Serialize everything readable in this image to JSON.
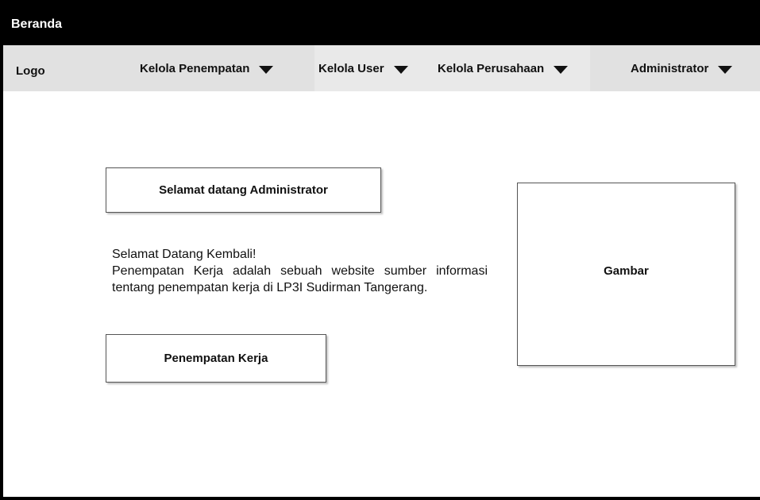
{
  "window": {
    "title": "Beranda"
  },
  "menu": {
    "logo": "Logo",
    "items": [
      {
        "label": "Kelola Penempatan"
      },
      {
        "label": "Kelola User"
      },
      {
        "label": "Kelola Perusahaan"
      },
      {
        "label": "Administrator"
      }
    ]
  },
  "main": {
    "welcome_box": "Selamat datang Administrator",
    "greeting": "Selamat Datang Kembali!",
    "description": "Penempatan Kerja adalah sebuah website sumber informasi tentang penempatan kerja di LP3I Sudirman Tangerang.",
    "button_label": "Penempatan Kerja",
    "image_placeholder": "Gambar"
  }
}
